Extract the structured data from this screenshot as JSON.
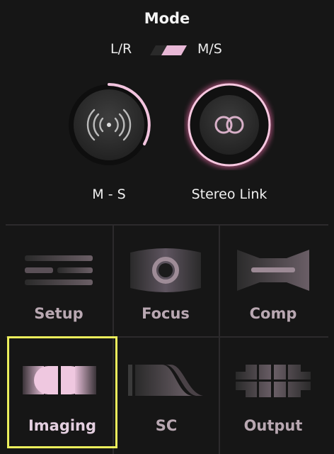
{
  "header": {
    "title": "Mode"
  },
  "mode_toggle": {
    "left_label": "L/R",
    "right_label": "M/S",
    "selected": "M/S"
  },
  "knobs": [
    {
      "label": "M - S",
      "icon": "broadcast-icon",
      "level": 0.35
    },
    {
      "label": "Stereo Link",
      "icon": "linked-rings-icon",
      "level": 1.0
    }
  ],
  "modules": [
    {
      "label": "Setup",
      "icon": "setup-lines-icon",
      "selected": false
    },
    {
      "label": "Focus",
      "icon": "focus-lens-icon",
      "selected": false
    },
    {
      "label": "Comp",
      "icon": "comp-shape-icon",
      "selected": false
    },
    {
      "label": "Imaging",
      "icon": "imaging-split-icon",
      "selected": true
    },
    {
      "label": "SC",
      "icon": "sidechain-curve-icon",
      "selected": false
    },
    {
      "label": "Output",
      "icon": "output-blocks-icon",
      "selected": false
    }
  ],
  "colors": {
    "accent": "#e8a8c8",
    "glow": "#f06aa8",
    "selection": "#ecef5c",
    "label_muted": "#b9a8b2"
  }
}
